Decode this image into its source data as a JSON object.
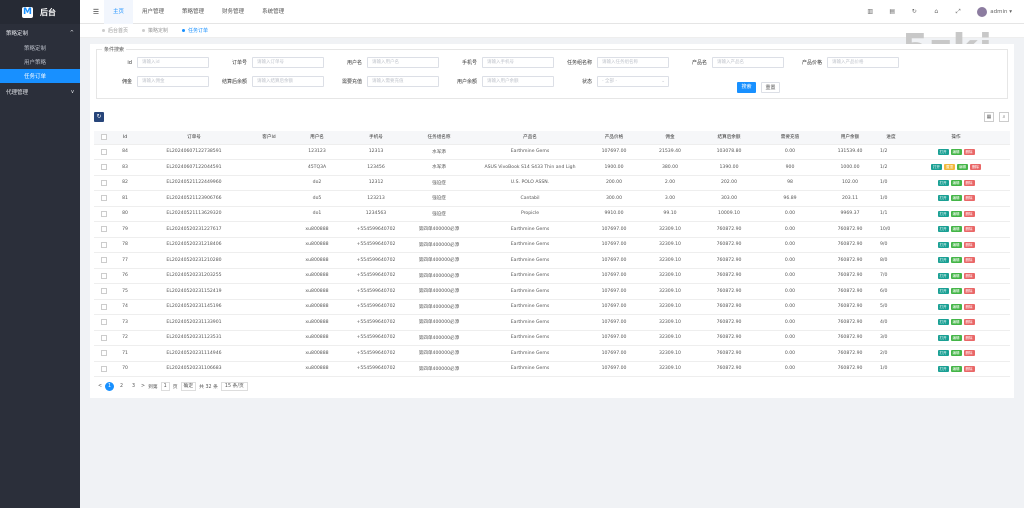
{
  "sidebar": {
    "logo_letter": "M",
    "logo_text": "后台",
    "groups": [
      {
        "label": "策略定制",
        "arrow": "^",
        "items": [
          {
            "label": "策略定制"
          },
          {
            "label": "用户策略"
          },
          {
            "label": "任务订单",
            "active": true
          }
        ]
      },
      {
        "label": "代理管理",
        "arrow": "v",
        "items": []
      }
    ]
  },
  "topbar": {
    "menu_icon": "☰",
    "tabs": [
      {
        "label": "主页",
        "active": true
      },
      {
        "label": "用户管理"
      },
      {
        "label": "策略管理"
      },
      {
        "label": "财务管理"
      },
      {
        "label": "系统管理"
      }
    ],
    "icons": [
      "chart-icon",
      "window-icon",
      "refresh-icon",
      "bell-icon",
      "expand-icon"
    ],
    "user": "admin ▾"
  },
  "page_tabs": [
    {
      "label": "后台首页"
    },
    {
      "label": "策略定制"
    },
    {
      "label": "任务订单",
      "active": true
    }
  ],
  "brand_watermark": "5zki",
  "search": {
    "legend": "条件搜索",
    "fields": [
      {
        "label": "id",
        "placeholder": "请输入id"
      },
      {
        "label": "订单号",
        "placeholder": "请输入订单号"
      },
      {
        "label": "用户名",
        "placeholder": "请输入用户名"
      },
      {
        "label": "手机号",
        "placeholder": "请输入手机号"
      },
      {
        "label": "任务组名称",
        "placeholder": "请输入任务组名称"
      },
      {
        "label": "产品名",
        "placeholder": "请输入产品名"
      },
      {
        "label": "产品价格",
        "placeholder": "请输入产品价格"
      },
      {
        "label": "佣金",
        "placeholder": "请输入佣金"
      },
      {
        "label": "结算后余额",
        "placeholder": "请输入结算后余额"
      },
      {
        "label": "需要充值",
        "placeholder": "请输入需要充值"
      },
      {
        "label": "用户余额",
        "placeholder": "请输入用户余额"
      },
      {
        "label": "状态",
        "placeholder": "- 全部 -"
      }
    ],
    "search_btn": "搜索",
    "reset_btn": "重置"
  },
  "table": {
    "columns": [
      "",
      "Id",
      "订单号",
      "客户Id",
      "用户名",
      "手机号",
      "任务组名称",
      "产品名",
      "产品价格",
      "佣金",
      "结算后余额",
      "需要充值",
      "用户余额",
      "进度",
      "操作"
    ],
    "rows": [
      [
        "84",
        "EL20240607122738591",
        "",
        "123123",
        "12313",
        "水军添",
        "Earthmine Gems",
        "107697.00",
        "21539.40",
        "103078.80",
        "0.00",
        "131539.40",
        "1/2",
        "",
        [
          "打开",
          "编辑",
          "删除"
        ]
      ],
      [
        "83",
        "EL20240607122044591",
        "",
        "45TQ3A",
        "123456",
        "水军添",
        "ASUS VivoBook S14 S433 Thin and Ligh",
        "1900.00",
        "380.00",
        "1390.00",
        "900",
        "1000.00",
        "1/2",
        "",
        [
          "打开",
          "置顶",
          "编辑",
          "删除"
        ]
      ],
      [
        "82",
        "EL20240521122449960",
        "",
        "do2",
        "12312",
        "强迫症",
        "U.S. POLO ASSN.",
        "200.00",
        "2.00",
        "202.00",
        "98",
        "102.00",
        "1/0",
        "已...",
        [
          "打开",
          "编辑",
          "删除"
        ]
      ],
      [
        "81",
        "EL20240521123906766",
        "",
        "do5",
        "123213",
        "强迫症",
        "Cantabil",
        "300.00",
        "3.00",
        "303.00",
        "96.89",
        "203.11",
        "1/0",
        "已...",
        [
          "打开",
          "编辑",
          "删除"
        ]
      ],
      [
        "80",
        "EL20240521113629320",
        "",
        "do1",
        "1234563",
        "强迫症",
        "Propicle",
        "9910.00",
        "99.10",
        "10009.10",
        "0.00",
        "9969.37",
        "1/1",
        "已...",
        [
          "打开",
          "编辑",
          "删除"
        ]
      ],
      [
        "79",
        "EL20240520231227617",
        "",
        "xu800888",
        "+554599640702",
        "第四单400000必添",
        "Earthmine Gems",
        "107697.00",
        "32309.10",
        "760872.90",
        "0.00",
        "760872.90",
        "10/0",
        "已...",
        [
          "打开",
          "编辑",
          "删除"
        ]
      ],
      [
        "78",
        "EL20240520231218406",
        "",
        "xu800888",
        "+554599640702",
        "第四单400000必添",
        "Earthmine Gems",
        "107697.00",
        "32309.10",
        "760872.90",
        "0.00",
        "760872.90",
        "9/0",
        "已...",
        [
          "打开",
          "编辑",
          "删除"
        ]
      ],
      [
        "77",
        "EL20240520231210280",
        "",
        "xu800888",
        "+554599640702",
        "第四单400000必添",
        "Earthmine Gems",
        "107697.00",
        "32309.10",
        "760872.90",
        "0.00",
        "760872.90",
        "8/0",
        "已...",
        [
          "打开",
          "编辑",
          "删除"
        ]
      ],
      [
        "76",
        "EL20240520231203255",
        "",
        "xu800888",
        "+554599640702",
        "第四单400000必添",
        "Earthmine Gems",
        "107697.00",
        "32309.10",
        "760872.90",
        "0.00",
        "760872.90",
        "7/0",
        "已...",
        [
          "打开",
          "编辑",
          "删除"
        ]
      ],
      [
        "75",
        "EL20240520231152419",
        "",
        "xu800888",
        "+554599640702",
        "第四单400000必添",
        "Earthmine Gems",
        "107697.00",
        "32309.10",
        "760872.90",
        "0.00",
        "760872.90",
        "6/0",
        "已...",
        [
          "打开",
          "编辑",
          "删除"
        ]
      ],
      [
        "74",
        "EL20240520231145196",
        "",
        "xu800888",
        "+554599640702",
        "第四单400000必添",
        "Earthmine Gems",
        "107697.00",
        "32309.10",
        "760872.90",
        "0.00",
        "760872.90",
        "5/0",
        "已...",
        [
          "打开",
          "编辑",
          "删除"
        ]
      ],
      [
        "73",
        "EL20240520231133901",
        "",
        "xu800888",
        "+554599640702",
        "第四单400000必添",
        "Earthmine Gems",
        "107697.00",
        "32309.10",
        "760872.90",
        "0.00",
        "760872.90",
        "4/0",
        "已...",
        [
          "打开",
          "编辑",
          "删除"
        ]
      ],
      [
        "72",
        "EL20240520231123531",
        "",
        "xu800888",
        "+554599640702",
        "第四单400000必添",
        "Earthmine Gems",
        "107697.00",
        "32309.10",
        "760872.90",
        "0.00",
        "760872.90",
        "3/0",
        "已...",
        [
          "打开",
          "编辑",
          "删除"
        ]
      ],
      [
        "71",
        "EL20240520231114946",
        "",
        "xu800888",
        "+554599640702",
        "第四单400000必添",
        "Earthmine Gems",
        "107697.00",
        "32309.10",
        "760872.90",
        "0.00",
        "760872.90",
        "2/0",
        "已...",
        [
          "打开",
          "编辑",
          "删除"
        ]
      ],
      [
        "70",
        "EL20240520231106683",
        "",
        "xu800888",
        "+554599640702",
        "第四单400000必添",
        "Earthmine Gems",
        "107697.00",
        "32309.10",
        "760872.90",
        "0.00",
        "760872.90",
        "1/0",
        "已...",
        [
          "打开",
          "编辑",
          "删除"
        ]
      ]
    ]
  },
  "pager": {
    "prev": "<",
    "pages": [
      "1",
      "2",
      "3"
    ],
    "next": ">",
    "goto_label": "到第",
    "goto_value": "1",
    "page_unit": "页",
    "confirm": "确定",
    "total": "共 32 条",
    "page_size": "15 条/页"
  }
}
